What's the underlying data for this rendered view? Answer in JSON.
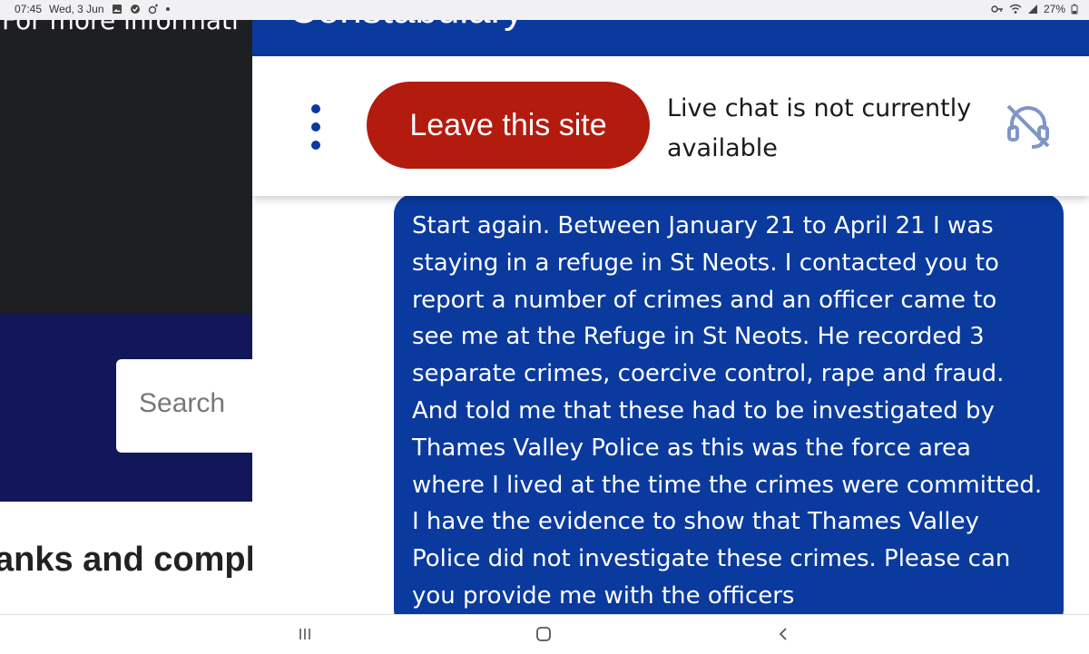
{
  "status_bar": {
    "time": "07:45",
    "date": "Wed, 3 Jun",
    "battery": "27%"
  },
  "background_page": {
    "info_text": "For more informati",
    "search_placeholder": "Search",
    "heading_fragment": "anks and compl"
  },
  "chat": {
    "header_title": "Constabulary",
    "leave_button": "Leave this site",
    "status_text": "Live chat is not currently available",
    "status_icon": "chat-unavailable-icon",
    "message": "Start again. Between January 21 to April 21 I was staying in a refuge in St Neots. I contacted you to report a number of crimes and an officer came to see me at the Refuge in St Neots.  He recorded 3 separate crimes,  coercive control, rape and fraud. And told me that these had to be investigated by Thames Valley Police as this was the force area where I lived at the time the crimes were committed. I have the evidence to show that Thames Valley Police did not investigate these crimes. Please can you provide me with the officers"
  },
  "colors": {
    "brand_blue": "#0a3a9e",
    "leave_red": "#b31b0e",
    "dark_bg": "#1e1f22",
    "navy_bg": "#121759"
  },
  "nav_bar": {
    "recents": "recents-icon",
    "home": "home-icon",
    "back": "back-icon"
  }
}
